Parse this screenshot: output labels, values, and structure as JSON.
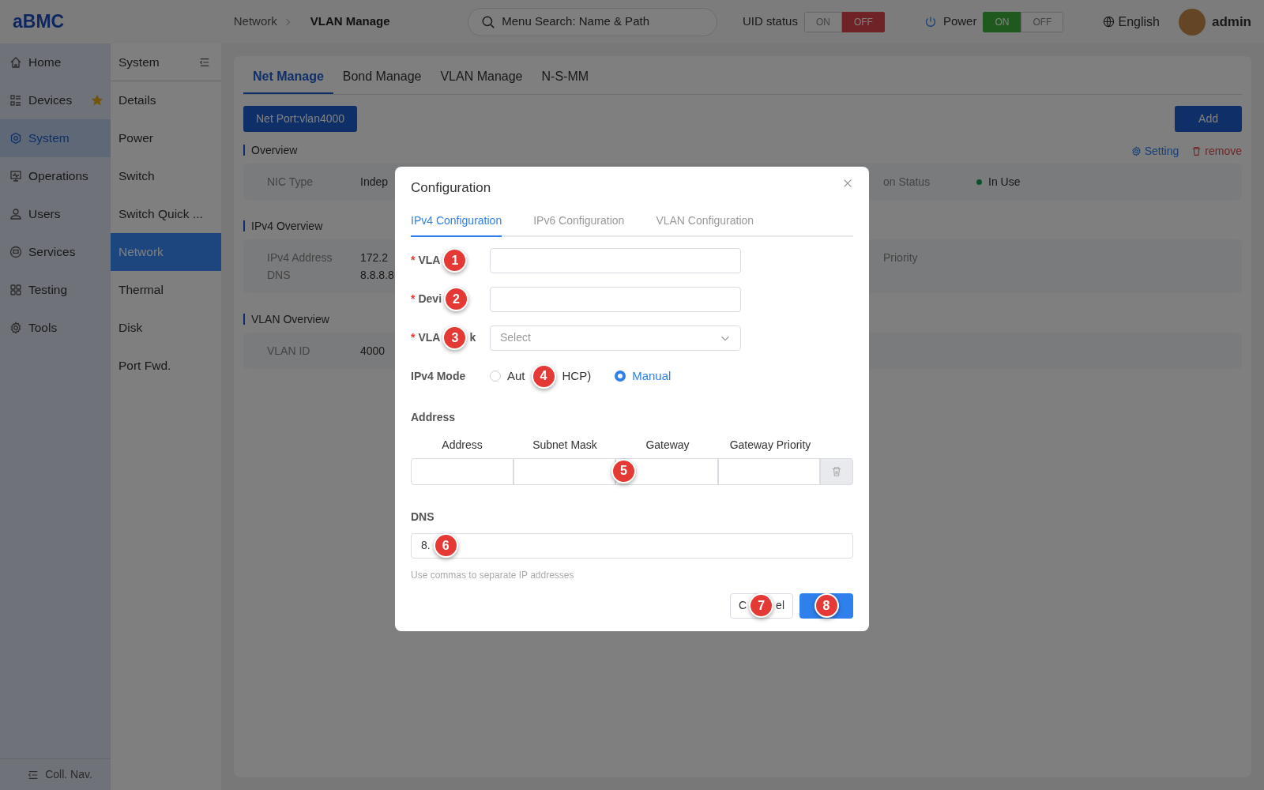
{
  "header": {
    "logo": "aBMC",
    "breadcrumb": [
      {
        "label": "Network"
      },
      {
        "label": "VLAN Manage"
      }
    ],
    "search": {
      "placeholder": "Menu Search: Name & Path"
    },
    "uid_status": {
      "label": "UID status",
      "options": [
        {
          "label": "ON",
          "selected": false
        },
        {
          "label": "OFF",
          "selected": true
        }
      ]
    },
    "power": {
      "label": "Power",
      "options": [
        {
          "label": "ON",
          "selected": true
        },
        {
          "label": "OFF",
          "selected": false
        }
      ]
    },
    "language": "English",
    "user": "admin"
  },
  "nav": {
    "items": [
      {
        "label": "Home",
        "selected": false,
        "starred": false
      },
      {
        "label": "Devices",
        "selected": false,
        "starred": true
      },
      {
        "label": "System",
        "selected": true,
        "starred": false
      },
      {
        "label": "Operations",
        "selected": false,
        "starred": false
      },
      {
        "label": "Users",
        "selected": false,
        "starred": false
      },
      {
        "label": "Services",
        "selected": false,
        "starred": false
      },
      {
        "label": "Testing",
        "selected": false,
        "starred": false
      },
      {
        "label": "Tools",
        "selected": false,
        "starred": false
      }
    ],
    "collapse": "Coll. Nav."
  },
  "subnav": {
    "title": "System",
    "items": [
      {
        "label": "Details",
        "selected": false
      },
      {
        "label": "Power",
        "selected": false
      },
      {
        "label": "Switch",
        "selected": false
      },
      {
        "label": "Switch Quick ...",
        "selected": false
      },
      {
        "label": "Network",
        "selected": true
      },
      {
        "label": "Thermal",
        "selected": false
      },
      {
        "label": "Disk",
        "selected": false
      },
      {
        "label": "Port Fwd.",
        "selected": false
      }
    ]
  },
  "content": {
    "tabs": [
      {
        "label": "Net Manage",
        "selected": true
      },
      {
        "label": "Bond Manage",
        "selected": false
      },
      {
        "label": "VLAN Manage",
        "selected": false
      },
      {
        "label": "N-S-MM",
        "selected": false
      }
    ],
    "port_button": "Net Port:vlan4000",
    "add_button": "Add",
    "sections": [
      {
        "title": "Overview",
        "actions": [
          {
            "kind": "setting",
            "label": "Setting"
          },
          {
            "kind": "remove",
            "label": "remove"
          }
        ],
        "rows": [
          [
            {
              "label": "NIC Type",
              "value": "Indep"
            },
            {
              "label": "on Status",
              "value": "In Use",
              "kind": "status"
            }
          ]
        ]
      },
      {
        "title": "IPv4 Overview",
        "rows": [
          [
            {
              "label": "IPv4 Address",
              "value": "172.2"
            },
            {
              "label": "Priority"
            }
          ],
          [
            {
              "label": "DNS",
              "value": "8.8.8.8"
            }
          ]
        ]
      },
      {
        "title": "VLAN Overview",
        "rows": [
          [
            {
              "label": "VLAN ID",
              "value": "4000"
            }
          ]
        ]
      }
    ]
  },
  "dialog": {
    "title": "Configuration",
    "tabs": [
      {
        "label": "IPv4 Configuration",
        "selected": true
      },
      {
        "label": "IPv6 Configuration",
        "selected": false
      },
      {
        "label": "VLAN Configuration",
        "selected": false
      }
    ],
    "fields": [
      {
        "kind": "text",
        "required_mark": "*",
        "label": "VLA",
        "marker": "1"
      },
      {
        "kind": "text",
        "required_mark": "*",
        "label": "Devi",
        "marker": "2"
      },
      {
        "kind": "select",
        "required_mark": "*",
        "label": "VLA",
        "label_tail": "k",
        "marker": "3",
        "placeholder": "Select"
      }
    ],
    "mode": {
      "label": "IPv4 Mode",
      "options": [
        {
          "text": "Aut",
          "text_tail": "HCP)",
          "marker": "4",
          "selected": false
        },
        {
          "text": "Manual",
          "selected": true
        }
      ]
    },
    "address": {
      "title": "Address",
      "columns": [
        {
          "label": "Address"
        },
        {
          "label": "Subnet Mask"
        },
        {
          "label": "Gateway",
          "marker": "5"
        },
        {
          "label": "Gateway Priority"
        }
      ]
    },
    "dns": {
      "label": "DNS",
      "value": "8.",
      "marker": "6",
      "hint": "Use commas to separate IP addresses"
    },
    "cancel": {
      "text": "C",
      "text_tail": "el",
      "marker": "7"
    },
    "ok": {
      "marker": "8"
    }
  }
}
